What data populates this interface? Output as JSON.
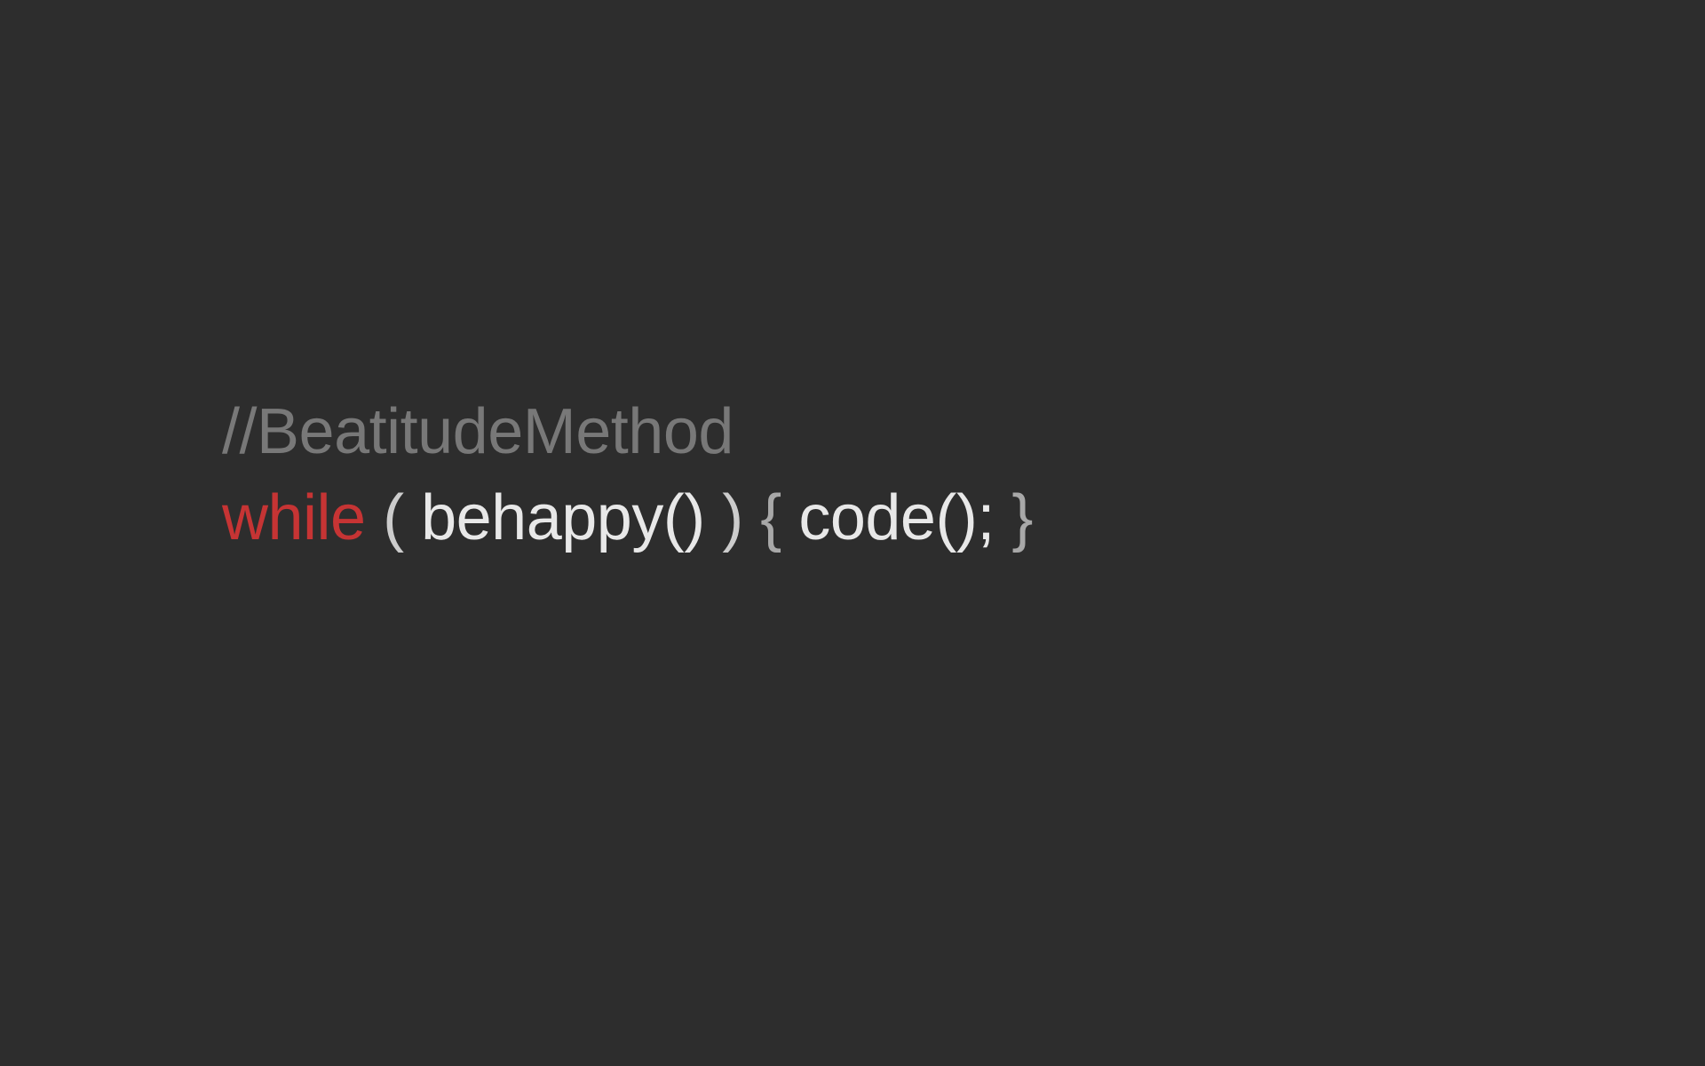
{
  "comment": "//BeatitudeMethod",
  "keyword": "while",
  "open_paren": " ( ",
  "condition": "behappy()",
  "close_paren": " ) ",
  "open_brace": "{ ",
  "body": "code();",
  "close_brace": " }"
}
